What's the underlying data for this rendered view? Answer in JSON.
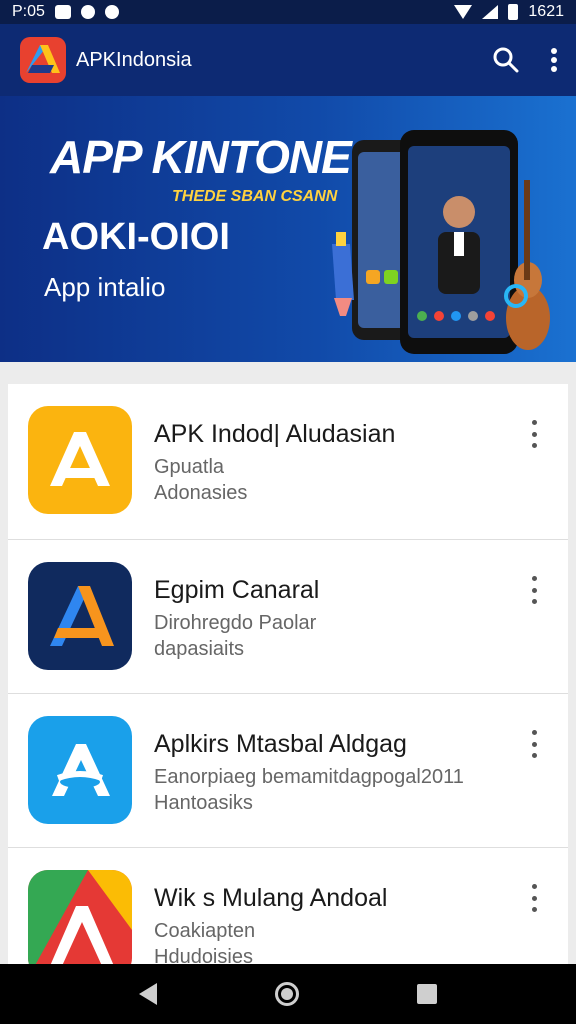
{
  "status_bar": {
    "time": "P:05",
    "right_text": "1621"
  },
  "app_bar": {
    "title": "APKIndonsia"
  },
  "banner": {
    "title": "APP KINTONE SA",
    "tagline": "THEDE SBAN CSANN",
    "code": "AOKI-OIOI",
    "subtitle": "App intalio"
  },
  "apps": [
    {
      "name": "APK Indod| Aludasian",
      "line1": "Gpuatla",
      "line2": "Adonasies",
      "icon": "apk-a-yellow-icon",
      "color": "#fbb40f"
    },
    {
      "name": "Egpim Canaral",
      "line1": "Dirohregdo Paolar",
      "line2": "dapasiaits",
      "icon": "apk-a-navy-orange-icon",
      "color": "#102a5e"
    },
    {
      "name": "Aplkirs Mtasbal Aldgag",
      "line1": "Eanorpiaeg bemamitdagpogal2011",
      "line2": "Hantoasiks",
      "icon": "apk-a-blue-icon",
      "color": "#1aa0ea"
    },
    {
      "name": "Wik s Mulang Andoal",
      "line1": "Coakiapten",
      "line2": "Hdudoisies",
      "icon": "apk-a-multicolor-icon",
      "color": "#33a852"
    }
  ]
}
